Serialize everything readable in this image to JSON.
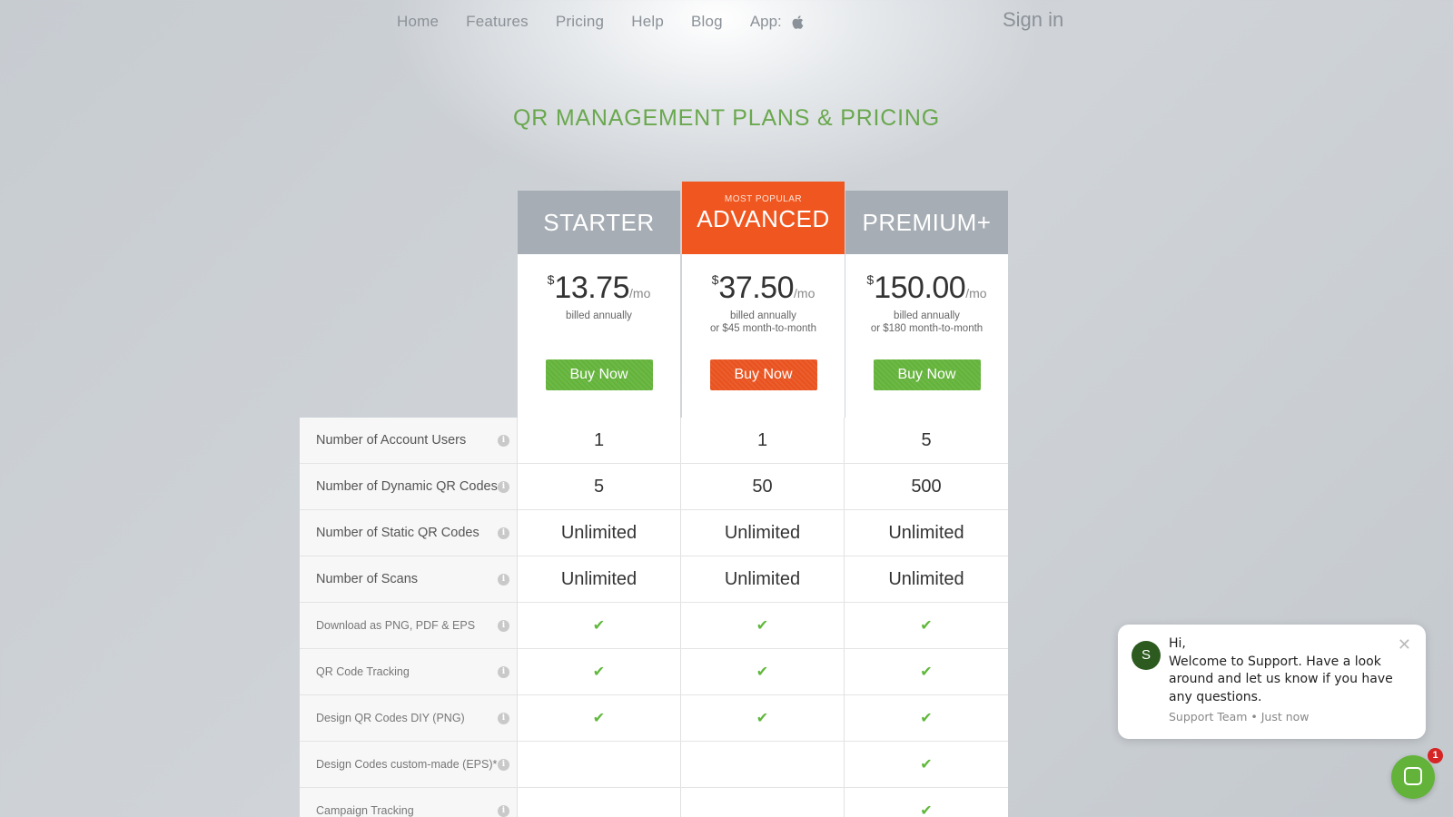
{
  "nav": {
    "items": [
      "Home",
      "Features",
      "Pricing",
      "Help",
      "Blog"
    ],
    "app_label": "App:",
    "app_icon": "apple-icon",
    "sign_in": "Sign in"
  },
  "title": "QR MANAGEMENT PLANS & PRICING",
  "plans": [
    {
      "name": "STARTER",
      "currency": "$",
      "amount": "13.75",
      "per": "/mo",
      "billing_line1": "billed annually",
      "billing_line2": "",
      "buy": "Buy Now"
    },
    {
      "tag": "MOST POPULAR",
      "name": "ADVANCED",
      "currency": "$",
      "amount": "37.50",
      "per": "/mo",
      "billing_line1": "billed annually",
      "billing_line2": "or $45 month-to-month",
      "buy": "Buy Now"
    },
    {
      "name": "PREMIUM+",
      "currency": "$",
      "amount": "150.00",
      "per": "/mo",
      "billing_line1": "billed annually",
      "billing_line2": "or $180 month-to-month",
      "buy": "Buy Now"
    }
  ],
  "features": [
    {
      "label": "Number of Account Users",
      "values": [
        "1",
        "1",
        "5"
      ]
    },
    {
      "label": "Number of Dynamic QR Codes",
      "values": [
        "5",
        "50",
        "500"
      ]
    },
    {
      "label": "Number of Static QR Codes",
      "values": [
        "Unlimited",
        "Unlimited",
        "Unlimited"
      ]
    },
    {
      "label": "Number of Scans",
      "values": [
        "Unlimited",
        "Unlimited",
        "Unlimited"
      ]
    },
    {
      "label": "Download as PNG, PDF & EPS",
      "values": [
        "check",
        "check",
        "check"
      ]
    },
    {
      "label": "QR Code Tracking",
      "values": [
        "check",
        "check",
        "check"
      ]
    },
    {
      "label": "Design QR Codes DIY (PNG)",
      "values": [
        "check",
        "check",
        "check"
      ]
    },
    {
      "label": "Design Codes custom-made (EPS)*",
      "values": [
        "",
        "",
        "check"
      ]
    },
    {
      "label": "Campaign Tracking",
      "values": [
        "",
        "",
        "check"
      ]
    }
  ],
  "chat": {
    "avatar": "S",
    "greeting": "Hi,",
    "message": "Welcome to Support. Have a look around and let us know if you have any questions.",
    "meta": "Support Team • Just now",
    "badge": "1"
  },
  "colors": {
    "accent_green": "#63b33a",
    "accent_orange": "#f0561f",
    "title_green": "#6aa84f",
    "plan_gray": "#a6adb4"
  }
}
